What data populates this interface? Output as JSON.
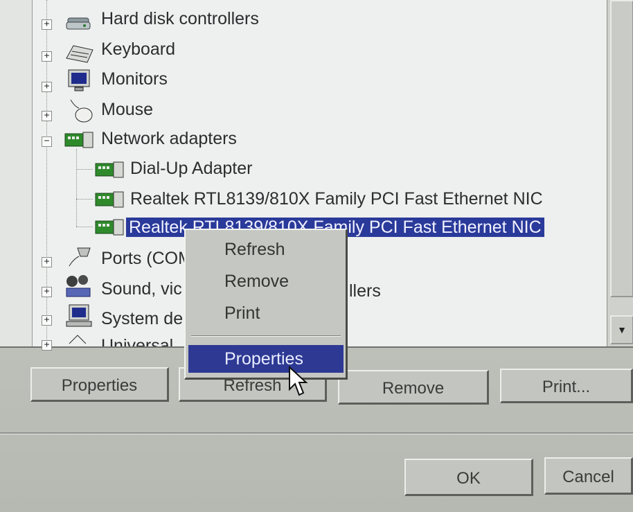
{
  "tree": {
    "items": [
      {
        "label": "Hard disk controllers",
        "icon": "hard-disk-controller-icon",
        "expander": "+"
      },
      {
        "label": "Keyboard",
        "icon": "keyboard-icon",
        "expander": "+"
      },
      {
        "label": "Monitors",
        "icon": "monitor-icon",
        "expander": "+"
      },
      {
        "label": "Mouse",
        "icon": "mouse-icon",
        "expander": "+"
      },
      {
        "label": "Network adapters",
        "icon": "network-adapter-icon",
        "expander": "−"
      },
      {
        "label": "Dial-Up Adapter",
        "icon": "network-card-icon"
      },
      {
        "label": "Realtek RTL8139/810X Family PCI Fast Ethernet NIC",
        "icon": "network-card-icon"
      },
      {
        "label": "Realtek RTL8139/810X Family PCI Fast Ethernet NIC",
        "icon": "network-card-icon",
        "selected": true
      },
      {
        "label": "Ports (COM",
        "icon": "port-icon",
        "expander": "+"
      },
      {
        "label": "Sound, vic",
        "suffix": "llers",
        "icon": "sound-icon",
        "expander": "+"
      },
      {
        "label": "System de",
        "icon": "system-device-icon",
        "expander": "+"
      },
      {
        "label": "Universal",
        "icon": "usb-icon",
        "expander": "+"
      }
    ]
  },
  "context_menu": {
    "items": [
      {
        "label": "Refresh",
        "mnemonic": "f"
      },
      {
        "label": "Remove",
        "mnemonic": "e"
      },
      {
        "label": "Print",
        "mnemonic": "n"
      },
      {
        "label": "Properties",
        "mnemonic": "o",
        "highlighted": true
      }
    ]
  },
  "buttons": {
    "properties": "Properties",
    "refresh": "Refresh",
    "remove": "Remove",
    "print": "Print...",
    "ok": "OK",
    "cancel": "Cancel"
  },
  "colors": {
    "selection": "#2a3a9a",
    "menu_highlight": "#2d3993",
    "face": "#c3c5c0"
  }
}
